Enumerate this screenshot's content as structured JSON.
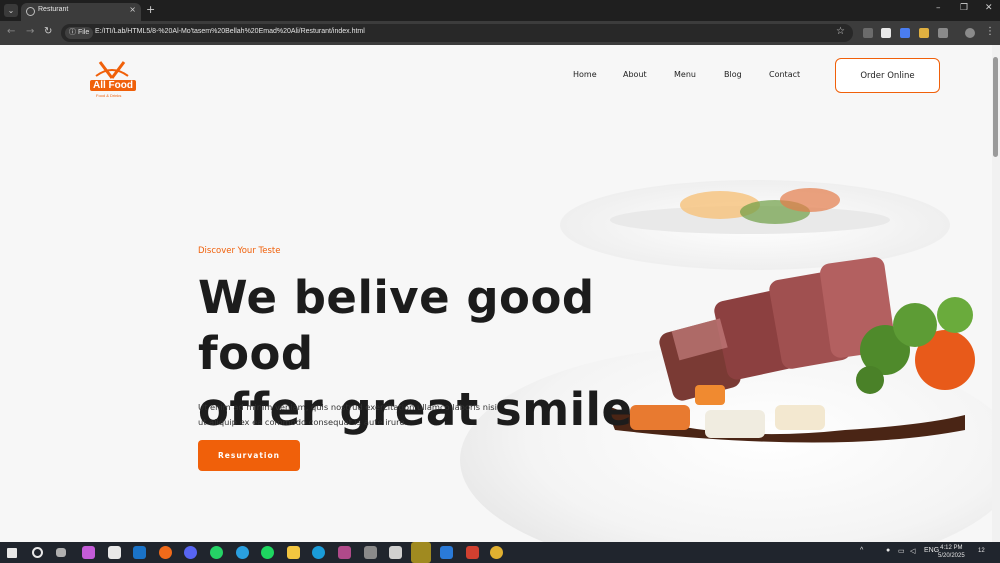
{
  "browser": {
    "tab_title": "Resturant",
    "tab_close": "×",
    "new_tab": "+",
    "url_chip": "File",
    "url": "E:/ITI/Lab/HTML5/8-%20Al-Mo'tasem%20Bellah%20Emad%20Ali/Resturant/index.html",
    "window_controls": [
      "–",
      "❐",
      "✕"
    ]
  },
  "site": {
    "logo_name": "All Food",
    "logo_tagline": "Food & Drinks",
    "nav": [
      "Home",
      "About",
      "Menu",
      "Blog",
      "Contact"
    ],
    "order_button": "Order Online",
    "hero": {
      "kicker": "Discover Your Teste",
      "headline_line1": "We belive good food",
      "headline_line2": "offer great smile",
      "body_line1": "Ut enim ad minim veniam, quis nostrud exercitation ullamco laboris nisi",
      "body_line2": "ut aliquip ex ea commodo consequat is aute irure.",
      "button": "Resurvation"
    }
  },
  "taskbar": {
    "language": "ENG",
    "time": "4:12 PM",
    "date": "5/20/2025",
    "notification_count": "12"
  },
  "colors": {
    "accent": "#f0600a",
    "text_dark": "#1c1c1c"
  }
}
